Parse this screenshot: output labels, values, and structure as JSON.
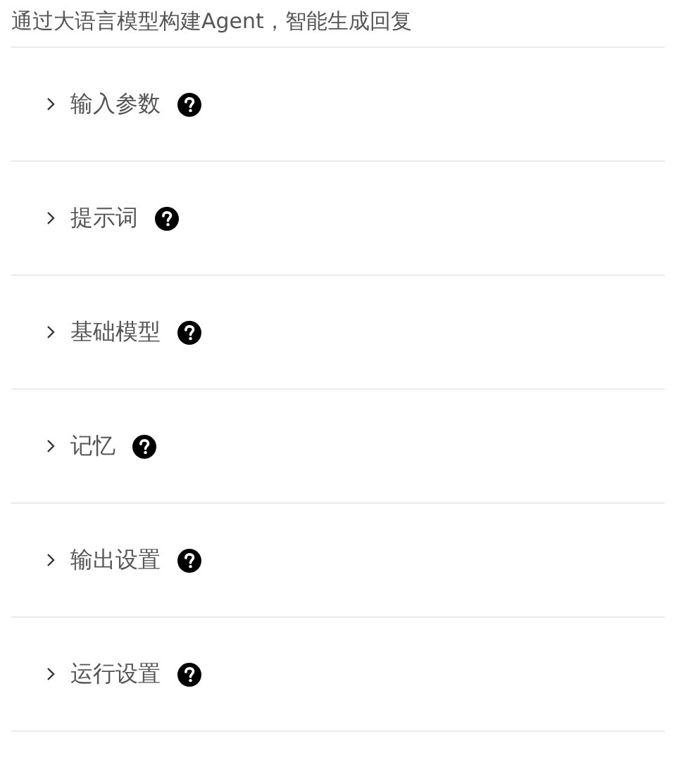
{
  "description": "通过大语言模型构建Agent，智能生成回复",
  "sections": [
    {
      "label": "输入参数",
      "expanded": false
    },
    {
      "label": "提示词",
      "expanded": false
    },
    {
      "label": "基础模型",
      "expanded": false
    },
    {
      "label": "记忆",
      "expanded": false
    },
    {
      "label": "输出设置",
      "expanded": false
    },
    {
      "label": "运行设置",
      "expanded": false
    }
  ]
}
